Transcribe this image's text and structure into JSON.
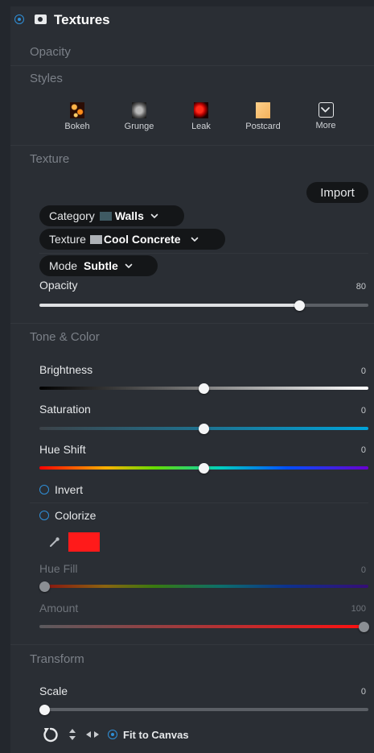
{
  "panel": {
    "title": "Textures",
    "opacity_section": "Opacity",
    "styles_section": "Styles"
  },
  "styles": [
    {
      "label": "Bokeh",
      "icon": "bokeh-thumbnail"
    },
    {
      "label": "Grunge",
      "icon": "grunge-thumbnail"
    },
    {
      "label": "Leak",
      "icon": "leak-thumbnail"
    },
    {
      "label": "Postcard",
      "icon": "postcard-thumbnail"
    },
    {
      "label": "More",
      "icon": "chevron-box-icon"
    }
  ],
  "texture": {
    "section": "Texture",
    "import_label": "Import",
    "category_label": "Category",
    "category_value": "Walls",
    "texture_label": "Texture",
    "texture_value": "Cool Concrete",
    "mode_label": "Mode",
    "mode_value": "Subtle",
    "opacity_label": "Opacity",
    "opacity_value": "80"
  },
  "tone": {
    "section": "Tone & Color",
    "brightness_label": "Brightness",
    "brightness_value": "0",
    "saturation_label": "Saturation",
    "saturation_value": "0",
    "hue_shift_label": "Hue Shift",
    "hue_shift_value": "0",
    "invert_label": "Invert",
    "colorize_label": "Colorize",
    "colorize_swatch": "#ff1a1a",
    "hue_fill_label": "Hue Fill",
    "hue_fill_value": "0",
    "amount_label": "Amount",
    "amount_value": "100"
  },
  "transform": {
    "section": "Transform",
    "scale_label": "Scale",
    "scale_value": "0",
    "fit_label": "Fit to Canvas"
  },
  "colors": {
    "accent": "#2f8fd8",
    "panel_bg": "#2a2e34",
    "pill_bg": "#141618"
  }
}
